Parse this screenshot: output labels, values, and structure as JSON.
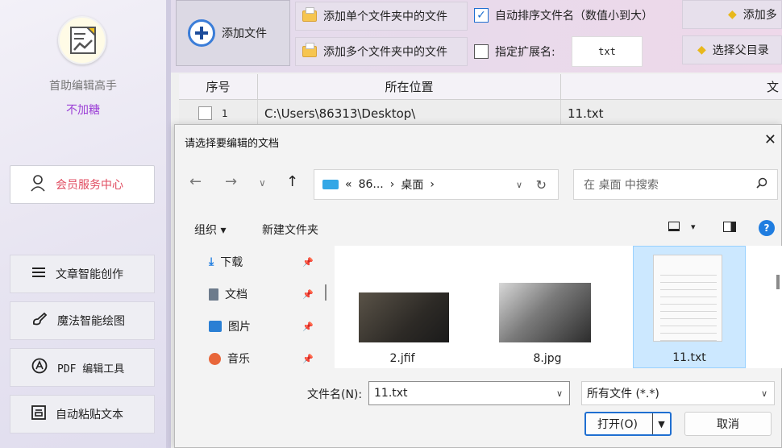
{
  "sidebar": {
    "app_name": "首助编辑高手",
    "app_sub": "不加糖",
    "member": "会员服务中心",
    "menu": [
      {
        "label": "文章智能创作"
      },
      {
        "label": "魔法智能绘图"
      },
      {
        "label": "PDF 编辑工具"
      },
      {
        "label": "自动粘贴文本"
      }
    ]
  },
  "toolbar": {
    "add_file": "添加文件",
    "add_single": "添加单个文件夹中的文件",
    "add_multi": "添加多个文件夹中的文件",
    "auto_sort": "自动排序文件名（数值小到大）",
    "auto_sort_checked": true,
    "ext_label": "指定扩展名:",
    "ext_checked": false,
    "ext_value": "txt",
    "add_more": "添加多",
    "choose_parent": "选择父目录"
  },
  "table": {
    "headers": [
      "序号",
      "所在位置",
      "文"
    ],
    "rows": [
      {
        "index": "1",
        "location": "C:\\Users\\86313\\Desktop\\",
        "name": "11.txt"
      }
    ]
  },
  "dialog": {
    "title": "请选择要编辑的文档",
    "close": "✕",
    "path_prefix": "«",
    "path_parent": "86...",
    "path_current": "桌面",
    "search_placeholder": "在 桌面 中搜索",
    "organize": "组织 ▾",
    "new_folder": "新建文件夹",
    "help": "?",
    "nav_items": [
      "下载",
      "文档",
      "图片",
      "音乐"
    ],
    "files": [
      {
        "name": "2.jfif",
        "selected": false
      },
      {
        "name": "8.jpg",
        "selected": false
      },
      {
        "name": "11.txt",
        "selected": true
      }
    ],
    "filename_label": "文件名(N):",
    "filename_value": "11.txt",
    "filter_value": "所有文件 (*.*)",
    "open": "打开(O)",
    "cancel": "取消"
  },
  "colors": {
    "accent": "#1f6fd1",
    "member_red": "#e04b5f",
    "purple": "#9b3fd6"
  }
}
